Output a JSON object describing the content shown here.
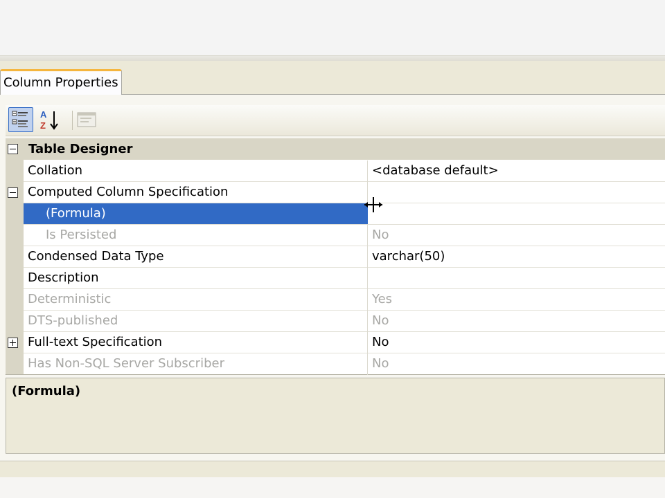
{
  "tab": {
    "label": "Column Properties"
  },
  "toolbar": {
    "categorized_icon": "categorized-icon",
    "alphabetical_icon": "alphabetical-sort-icon",
    "property_pages_icon": "property-pages-icon"
  },
  "category": {
    "label": "Table Designer",
    "expanded": true
  },
  "rows": [
    {
      "name": "Collation",
      "value": "<database default>",
      "enabled": true
    },
    {
      "name": "Computed Column Specification",
      "value": "",
      "enabled": true,
      "expander": "minus"
    },
    {
      "name": "(Formula)",
      "value": "",
      "enabled": true,
      "selected": true,
      "indent": true
    },
    {
      "name": "Is Persisted",
      "value": "No",
      "enabled": false,
      "indent": true
    },
    {
      "name": "Condensed Data Type",
      "value": "varchar(50)",
      "enabled": true
    },
    {
      "name": "Description",
      "value": "",
      "enabled": true
    },
    {
      "name": "Deterministic",
      "value": "Yes",
      "enabled": false
    },
    {
      "name": "DTS-published",
      "value": "No",
      "enabled": false
    },
    {
      "name": "Full-text Specification",
      "value": "No",
      "enabled": true,
      "expander": "plus"
    },
    {
      "name": "Has Non-SQL Server Subscriber",
      "value": "No",
      "enabled": false
    }
  ],
  "description_panel": {
    "title": "(Formula)"
  },
  "colors": {
    "selection": "#316ac5",
    "tab_accent": "#f5b53d",
    "disabled_text": "#a7a7a4"
  }
}
